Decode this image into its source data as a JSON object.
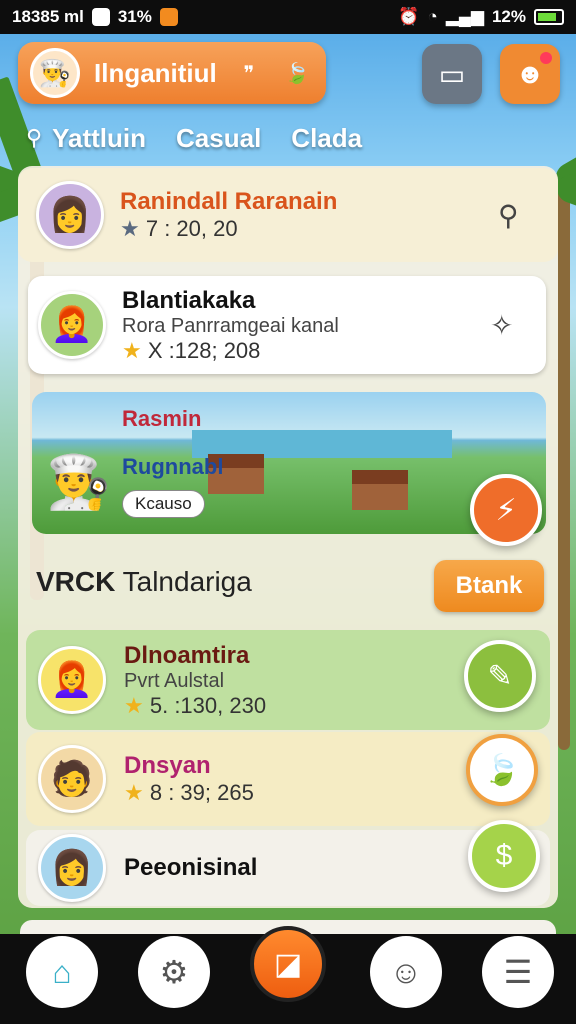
{
  "status_bar": {
    "time": "18385 ml",
    "signal_text": "31%",
    "battery_text": "12%"
  },
  "header": {
    "title": "Ilnganitiul",
    "quote_icon": "quote-icon",
    "leaf_icon": "leaf-icon"
  },
  "filters": {
    "items": [
      "Yattluin",
      "Casual",
      "Clada"
    ]
  },
  "cards": [
    {
      "name": "Ranindall Raranain",
      "stat": "7 : 20, 20"
    },
    {
      "name": "Blantiakaka",
      "sub": "Rora Panrramgeai kanal",
      "stat": "X :128; 208"
    }
  ],
  "banner": {
    "title": "Rasmin",
    "subtitle": "Rugnnabl",
    "tag": "Kcauso"
  },
  "section": {
    "prefix": "VRCK",
    "title": "Talndariga",
    "button": "Btank"
  },
  "list": [
    {
      "name": "Dlnoamtira",
      "sub": "Pvrt Aulstal",
      "stat": "5. :130, 230"
    },
    {
      "name": "Dnsyan",
      "stat": "8 : 39; 265"
    },
    {
      "name": "Peeonisinal"
    }
  ],
  "colors": {
    "accent": "#ee7f2e",
    "green_card": "#c9e6a8",
    "yellow_card": "#f5ecc4"
  }
}
